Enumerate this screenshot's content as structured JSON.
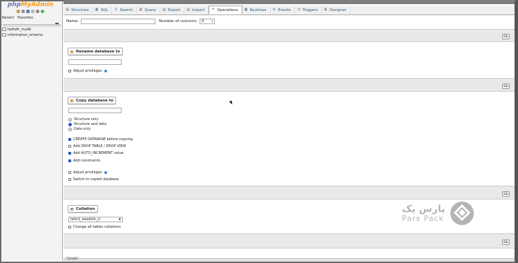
{
  "app": {
    "logo_php": "php",
    "logo_admin": "MyAdmin"
  },
  "nav": {
    "links": [
      "Recent",
      "Favorites"
    ],
    "databases": [
      "hjdhdh_mydb",
      "information_schema"
    ]
  },
  "breadcrumb": "",
  "tabs": [
    {
      "label": "Structure",
      "icon": "table-icon",
      "glyph": "▤"
    },
    {
      "label": "SQL",
      "icon": "sql-icon",
      "glyph": "▦"
    },
    {
      "label": "Search",
      "icon": "search-icon",
      "glyph": "⚲"
    },
    {
      "label": "Query",
      "icon": "query-icon",
      "glyph": "▥"
    },
    {
      "label": "Export",
      "icon": "export-icon",
      "glyph": "▤"
    },
    {
      "label": "Import",
      "icon": "import-icon",
      "glyph": "▤"
    },
    {
      "label": "Operations",
      "icon": "wrench-icon",
      "glyph": "✎",
      "active": true
    },
    {
      "label": "Routines",
      "icon": "routines-icon",
      "glyph": "▦"
    },
    {
      "label": "Events",
      "icon": "clock-icon",
      "glyph": "⊘"
    },
    {
      "label": "Triggers",
      "icon": "triggers-icon",
      "glyph": "⇉"
    },
    {
      "label": "Designer",
      "icon": "designer-icon",
      "glyph": "⧉"
    }
  ],
  "create_table": {
    "name_label": "Name:",
    "columns_label": "Number of columns:",
    "columns_value": "4",
    "go": "Go"
  },
  "rename": {
    "title": "Rename database to",
    "adjust": "Adjust privileges",
    "go": "Go"
  },
  "copy": {
    "title": "Copy database to",
    "radios": [
      "Structure only",
      "Structure and data",
      "Data only"
    ],
    "options": [
      {
        "label": "CREATE DATABASE before copying",
        "checked": true
      },
      {
        "label": "Add DROP TABLE / DROP VIEW",
        "checked": false
      },
      {
        "label": "Add AUTO_INCREMENT value",
        "checked": true
      },
      {
        "label": "Add constraints",
        "checked": true
      }
    ],
    "adjust": "Adjust privileges",
    "switch": "Switch to copied database",
    "go": "Go"
  },
  "collation": {
    "title": "Collation",
    "selected": "latin1_swedish_ci",
    "change_all": "Change all tables collations",
    "go": "Go"
  },
  "console": "Console",
  "watermark": {
    "fa": "پارس پک",
    "en": "Pars Pack"
  },
  "colors": {
    "accent": "#1a66d6",
    "link": "#235a81",
    "logo_blue": "#6c78af",
    "logo_orange": "#f89c0e"
  }
}
